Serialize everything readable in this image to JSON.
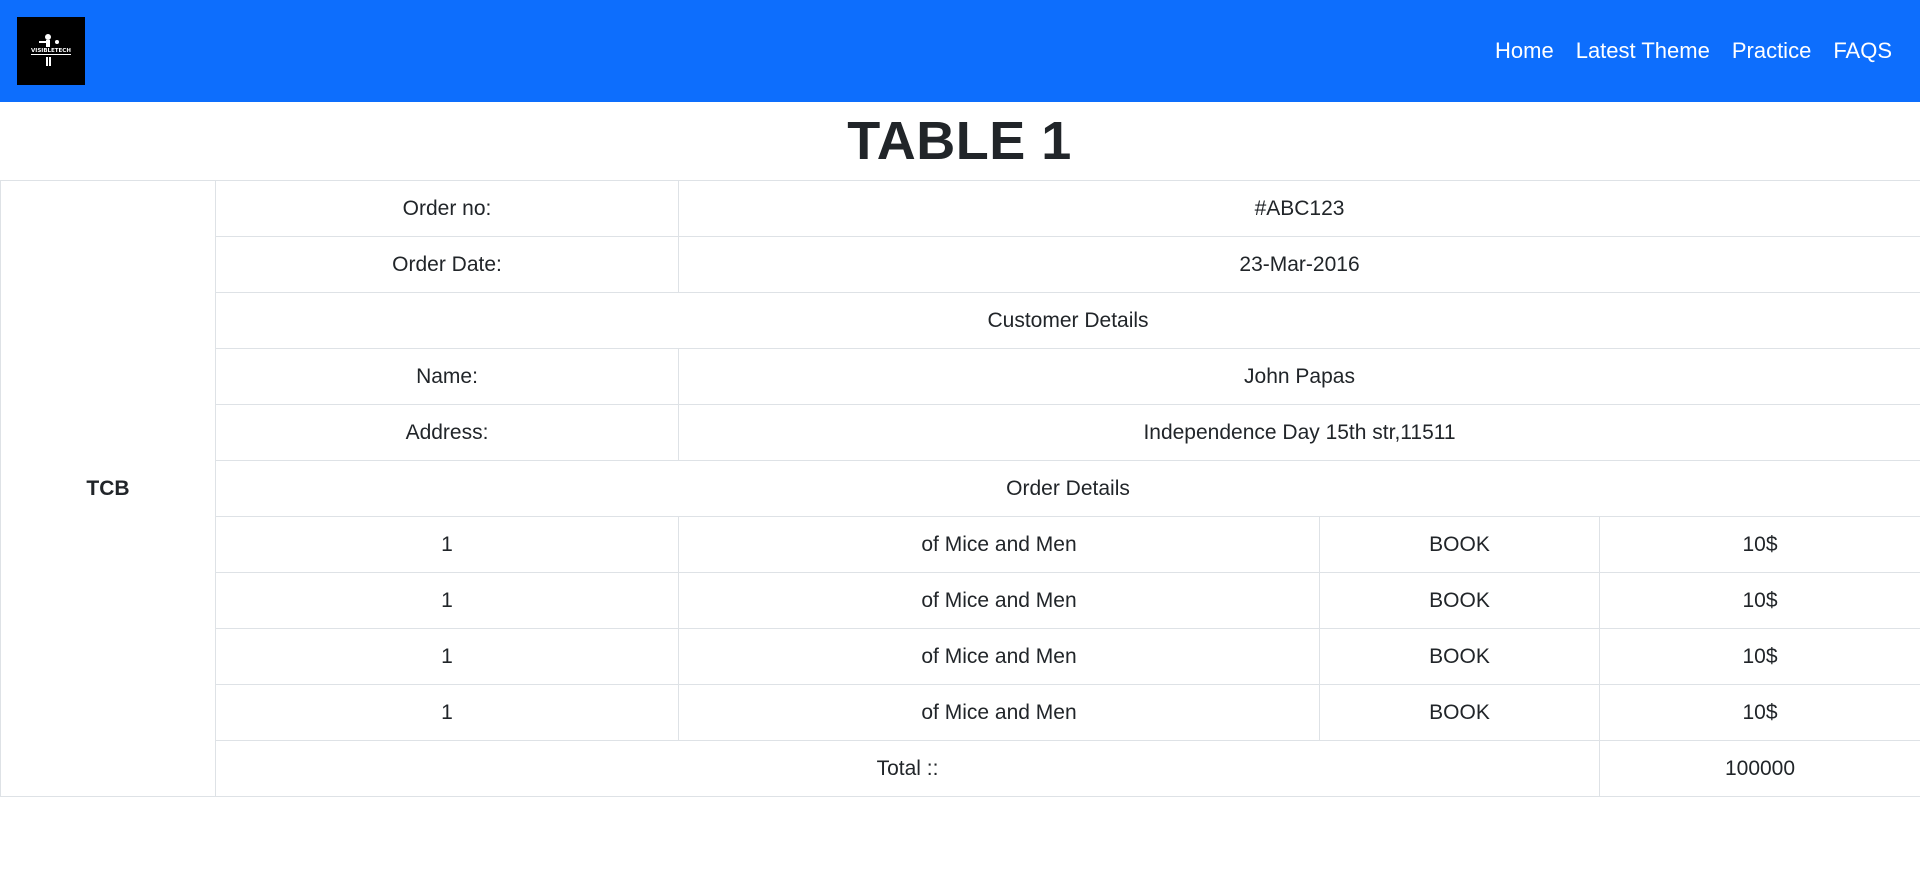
{
  "nav": {
    "logo_text": "VISIBLETECH",
    "links": [
      "Home",
      "Latest Theme",
      "Practice",
      "FAQS"
    ]
  },
  "page_title": "TABLE 1",
  "table": {
    "side_label": "TCB",
    "order_no_label": "Order no:",
    "order_no_value": "#ABC123",
    "order_date_label": "Order Date:",
    "order_date_value": "23-Mar-2016",
    "customer_details_heading": "Customer Details",
    "name_label": "Name:",
    "name_value": "John Papas",
    "address_label": "Address:",
    "address_value": "Independence Day 15th str,11511",
    "order_details_heading": "Order Details",
    "items": [
      {
        "qty": "1",
        "title": "of Mice and Men",
        "type": "BOOK",
        "price": "10$"
      },
      {
        "qty": "1",
        "title": "of Mice and Men",
        "type": "BOOK",
        "price": "10$"
      },
      {
        "qty": "1",
        "title": "of Mice and Men",
        "type": "BOOK",
        "price": "10$"
      },
      {
        "qty": "1",
        "title": "of Mice and Men",
        "type": "BOOK",
        "price": "10$"
      }
    ],
    "total_label": "Total ::",
    "total_value": "100000"
  },
  "colors": {
    "navbar": "#0d6efd",
    "border": "#dee2e6",
    "text": "#212529"
  }
}
